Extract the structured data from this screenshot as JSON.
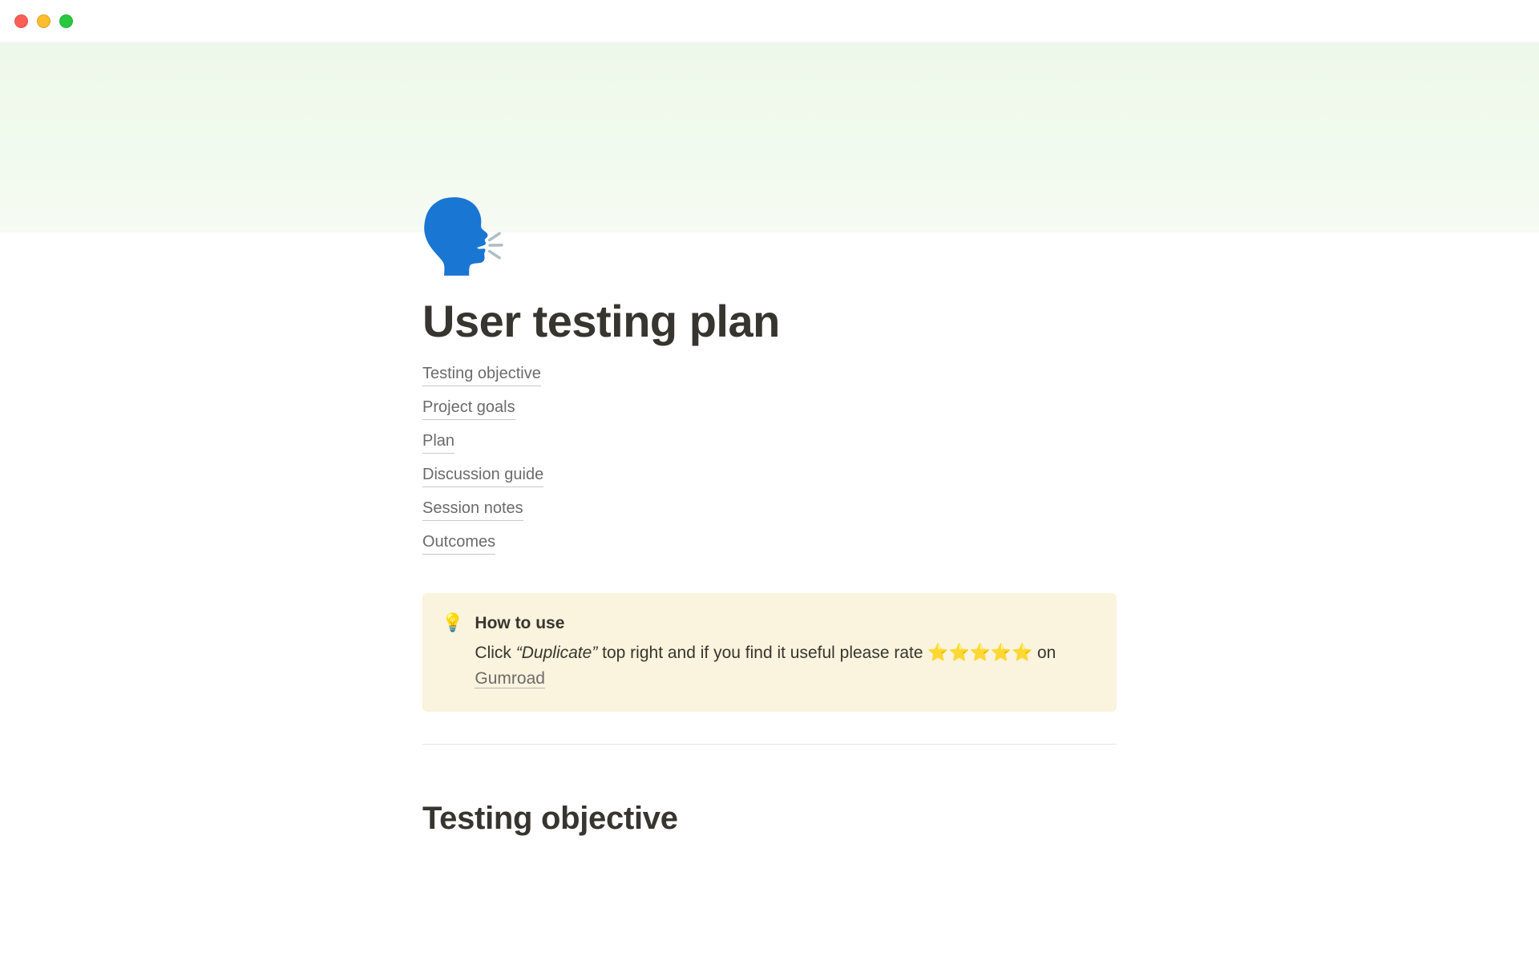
{
  "page": {
    "icon_emoji": "🗣️",
    "title": "User testing plan"
  },
  "toc": {
    "items": [
      {
        "label": "Testing objective"
      },
      {
        "label": "Project goals"
      },
      {
        "label": "Plan"
      },
      {
        "label": "Discussion guide"
      },
      {
        "label": "Session notes"
      },
      {
        "label": "Outcomes"
      }
    ]
  },
  "callout": {
    "icon": "💡",
    "title": "How to use",
    "pre_text": "Click ",
    "quote_open": "“",
    "duplicate_word": "Duplicate",
    "quote_close": "”",
    "mid_text": " top right and if you find it useful please rate ",
    "stars": "⭐️⭐️⭐️⭐️⭐️",
    "on_text": " on ",
    "link_label": "Gumroad"
  },
  "sections": {
    "first_heading": "Testing objective"
  }
}
